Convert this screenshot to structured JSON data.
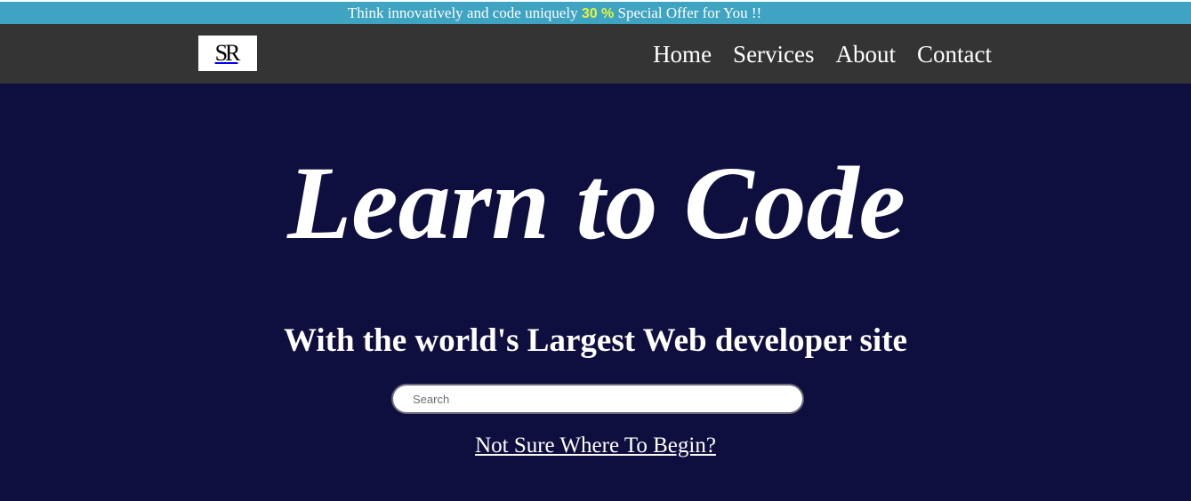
{
  "promo": {
    "text_before": "Think innovatively and code uniquely ",
    "highlight": "30 %",
    "text_after": " Special Offer for You !!",
    "highlight_color": "#e7f53a",
    "background_color": "#3fa3c2"
  },
  "navbar": {
    "logo_text": "SR",
    "links": [
      {
        "label": "Home"
      },
      {
        "label": "Services"
      },
      {
        "label": "About"
      },
      {
        "label": "Contact"
      }
    ],
    "background_color": "#343434"
  },
  "hero": {
    "title": "Learn to Code",
    "subtitle": "With the world's Largest Web developer site",
    "search": {
      "placeholder": "Search",
      "value": ""
    },
    "begin_link": "Not Sure Where To Begin?",
    "background_color": "#0f0f3f"
  }
}
